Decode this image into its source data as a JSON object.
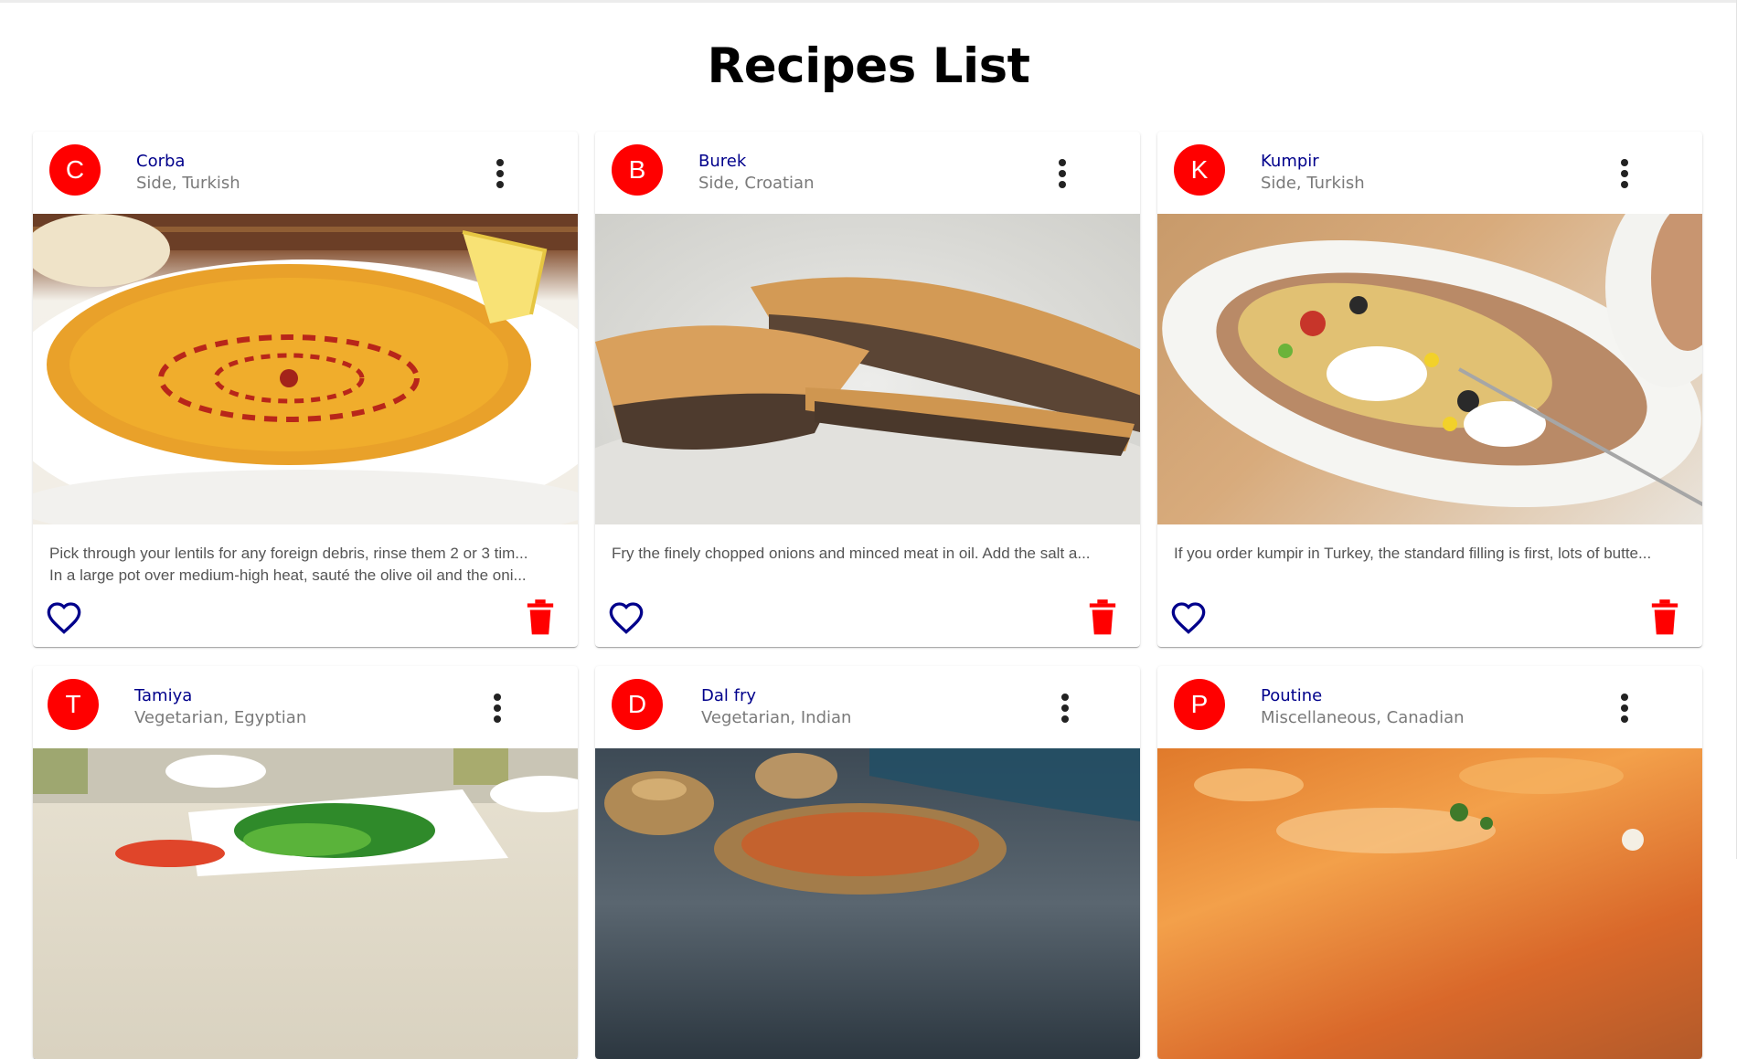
{
  "page": {
    "title": "Recipes List"
  },
  "recipes": [
    {
      "initial": "C",
      "title": "Corba",
      "subheader": "Side, Turkish",
      "description": [
        "Pick through your lentils for any foreign debris, rinse them 2 or 3 tim...",
        "In a large pot over medium-high heat, sauté the olive oil and the oni..."
      ]
    },
    {
      "initial": "B",
      "title": "Burek",
      "subheader": "Side, Croatian",
      "description": [
        "Fry the finely chopped onions and minced meat in oil. Add the salt a...",
        ""
      ]
    },
    {
      "initial": "K",
      "title": "Kumpir",
      "subheader": "Side, Turkish",
      "description": [
        "If you order kumpir in Turkey, the standard filling is first, lots of butte...",
        ""
      ]
    },
    {
      "initial": "T",
      "title": "Tamiya",
      "subheader": "Vegetarian, Egyptian",
      "description": [
        "",
        ""
      ]
    },
    {
      "initial": "D",
      "title": "Dal fry",
      "subheader": "Vegetarian, Indian",
      "description": [
        "",
        ""
      ]
    },
    {
      "initial": "P",
      "title": "Poutine",
      "subheader": "Miscellaneous, Canadian",
      "description": [
        "",
        ""
      ]
    }
  ],
  "icons": {
    "more": "more-vert-icon",
    "favorite": "heart-outline-icon",
    "delete": "trash-icon"
  },
  "colors": {
    "avatar": "#ff0000",
    "title": "#00008b",
    "subheader": "#7a7a7a",
    "favorite": "#00008b",
    "delete": "#ff0000"
  }
}
